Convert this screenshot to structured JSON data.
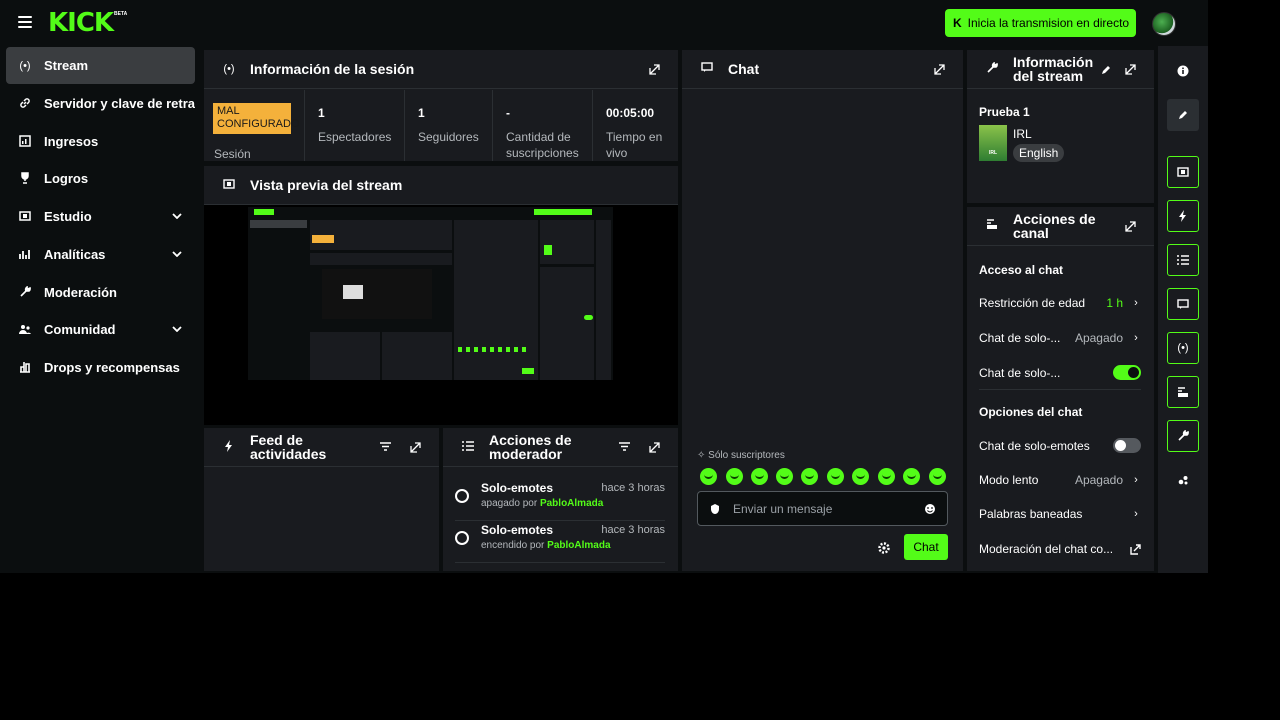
{
  "topbar": {
    "logo": "KICK",
    "logo_badge": "BETA",
    "go_live_label": "Inicia la transmision en directo",
    "colors": {
      "accent": "#53fc18",
      "background": "#0b0e0f",
      "panel": "#191b1f"
    }
  },
  "sidebar": {
    "items": [
      {
        "label": "Stream",
        "icon": "broadcast-icon",
        "active": true
      },
      {
        "label": "Servidor y clave de retransmision",
        "icon": "link-icon"
      },
      {
        "label": "Ingresos",
        "icon": "chart-bar-icon"
      },
      {
        "label": "Logros",
        "icon": "trophy-icon"
      },
      {
        "label": "Estudio",
        "icon": "film-icon",
        "expandable": true
      },
      {
        "label": "Analíticas",
        "icon": "analytics-icon",
        "expandable": true
      },
      {
        "label": "Moderación",
        "icon": "wrench-icon"
      },
      {
        "label": "Comunidad",
        "icon": "community-icon",
        "expandable": true
      },
      {
        "label": "Drops y recompensas",
        "icon": "gift-icon"
      }
    ]
  },
  "session": {
    "title": "Información de la sesión",
    "status_badge": "MAL CONFIGURADO",
    "status_label": "Sesión",
    "stats": [
      {
        "value": "1",
        "label": "Espectadores"
      },
      {
        "value": "1",
        "label": "Seguidores"
      },
      {
        "value": "-",
        "label": "Cantidad de suscripciones"
      },
      {
        "value": "00:05:00",
        "label": "Tiempo en vivo"
      }
    ]
  },
  "preview": {
    "title": "Vista previa del stream"
  },
  "activity_feed": {
    "title": "Feed de actividades"
  },
  "mod_actions": {
    "title": "Acciones de moderador",
    "items": [
      {
        "title": "Solo-emotes",
        "time": "hace 3 horas",
        "status": "apagado por",
        "user": "PabloAlmada"
      },
      {
        "title": "Solo-emotes",
        "time": "hace 3 horas",
        "status": "encendido por",
        "user": "PabloAlmada"
      }
    ]
  },
  "chat": {
    "title": "Chat",
    "subscribers_only": "Sólo suscriptores",
    "input_placeholder": "Enviar un mensaje",
    "send_label": "Chat"
  },
  "stream_info": {
    "title": "Información del stream",
    "stream_title": "Prueba 1",
    "category": "IRL",
    "thumb_text": "IRL",
    "tag": "English"
  },
  "channel_actions": {
    "title": "Acciones de canal",
    "access_heading": "Acceso al chat",
    "age_label": "Restricción de edad",
    "age_value": "1 h",
    "chat_solo_1": "Chat de solo-...",
    "chat_solo_1_value": "Apagado",
    "chat_solo_2": "Chat de solo-...",
    "options_heading": "Opciones del chat",
    "emotes_label": "Chat de solo-emotes",
    "slow_label": "Modo lento",
    "slow_value": "Apagado",
    "banned_label": "Palabras baneadas",
    "moderation_label": "Moderación del chat co..."
  }
}
